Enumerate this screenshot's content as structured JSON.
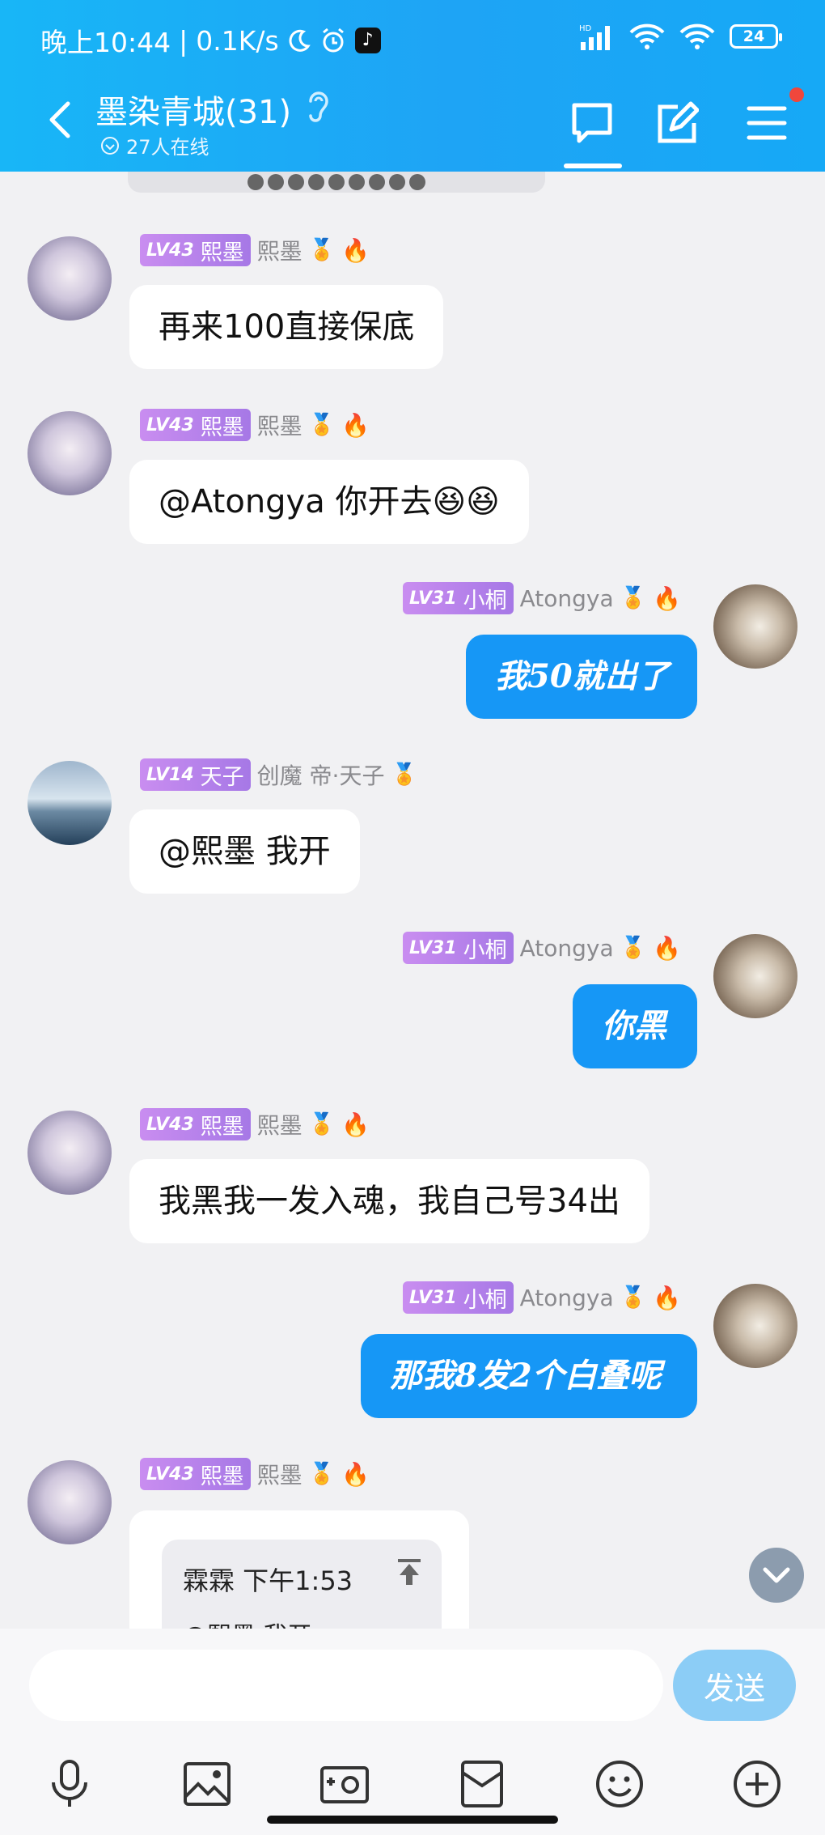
{
  "status_bar": {
    "time": "晚上10:44",
    "speed": "0.1K/s",
    "network": "HD",
    "battery": "24"
  },
  "header": {
    "title": "墨染青城(31)",
    "online": "27人在线"
  },
  "messages": [
    {
      "level": "LV43",
      "title_tag": "熙墨",
      "nickname": "熙墨",
      "text": "再来100直接保底"
    },
    {
      "level": "LV43",
      "title_tag": "熙墨",
      "nickname": "熙墨",
      "text": "@Atongya 你开去😆😆"
    },
    {
      "level": "LV31",
      "title_tag": "小桐",
      "nickname": "Atongya",
      "text": "我50就出了"
    },
    {
      "level": "LV14",
      "title_tag": "天子",
      "nickname": "创魔 帝·天子",
      "text": "@熙墨  我开"
    },
    {
      "level": "LV31",
      "title_tag": "小桐",
      "nickname": "Atongya",
      "text": "你黑"
    },
    {
      "level": "LV43",
      "title_tag": "熙墨",
      "nickname": "熙墨",
      "text": "我黑我一发入魂，我自己号34出"
    },
    {
      "level": "LV31",
      "title_tag": "小桐",
      "nickname": "Atongya",
      "text": "那我8发2个白叠呢"
    },
    {
      "level": "LV43",
      "title_tag": "熙墨",
      "nickname": "熙墨"
    }
  ],
  "quote": {
    "header": "霖霖  下午1:53",
    "text": "@熙墨  我开"
  },
  "input": {
    "placeholder": "",
    "send_label": "发送"
  }
}
